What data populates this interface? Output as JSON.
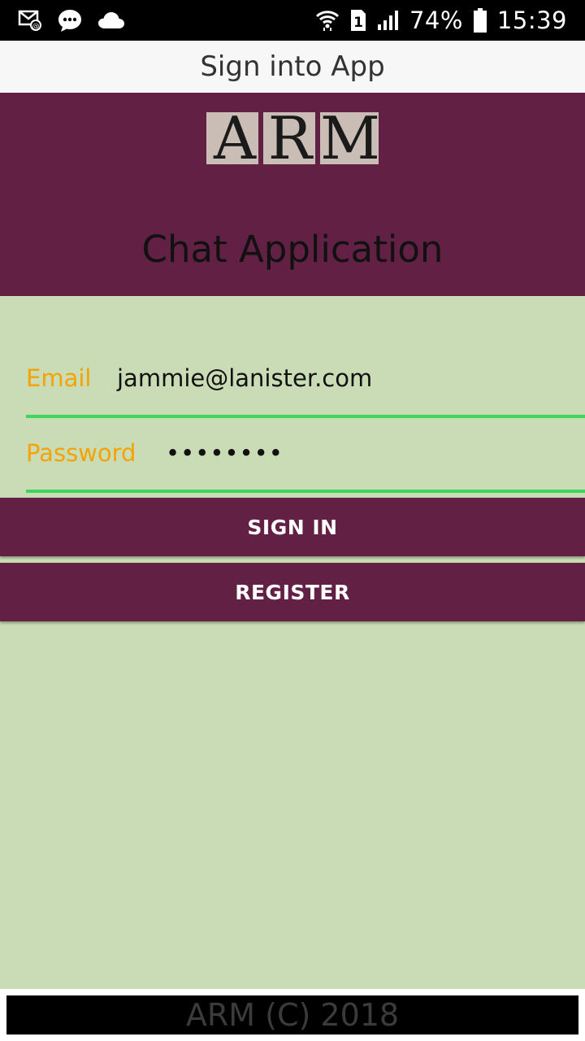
{
  "status_bar": {
    "battery": "74%",
    "time": "15:39",
    "sim_slot": "1",
    "icons": [
      "email-notification-icon",
      "message-icon",
      "cloud-icon",
      "wifi-icon",
      "sim-icon",
      "signal-icon",
      "battery-icon"
    ]
  },
  "title_bar": {
    "title": "Sign into App"
  },
  "header": {
    "logo_letters": [
      "A",
      "R",
      "M"
    ],
    "app_title": "Chat Application"
  },
  "form": {
    "email_label": "Email",
    "email_value": "jammie@lanister.com",
    "password_label": "Password",
    "password_value": "••••••••",
    "signin_label": "SIGN IN",
    "register_label": "REGISTER"
  },
  "footer": {
    "text": "ARM (C) 2018"
  },
  "colors": {
    "header_bg": "#612044",
    "main_bg": "#cadcb5",
    "label": "#f5a300",
    "underline": "#3fd45c",
    "button_bg": "#612044"
  }
}
